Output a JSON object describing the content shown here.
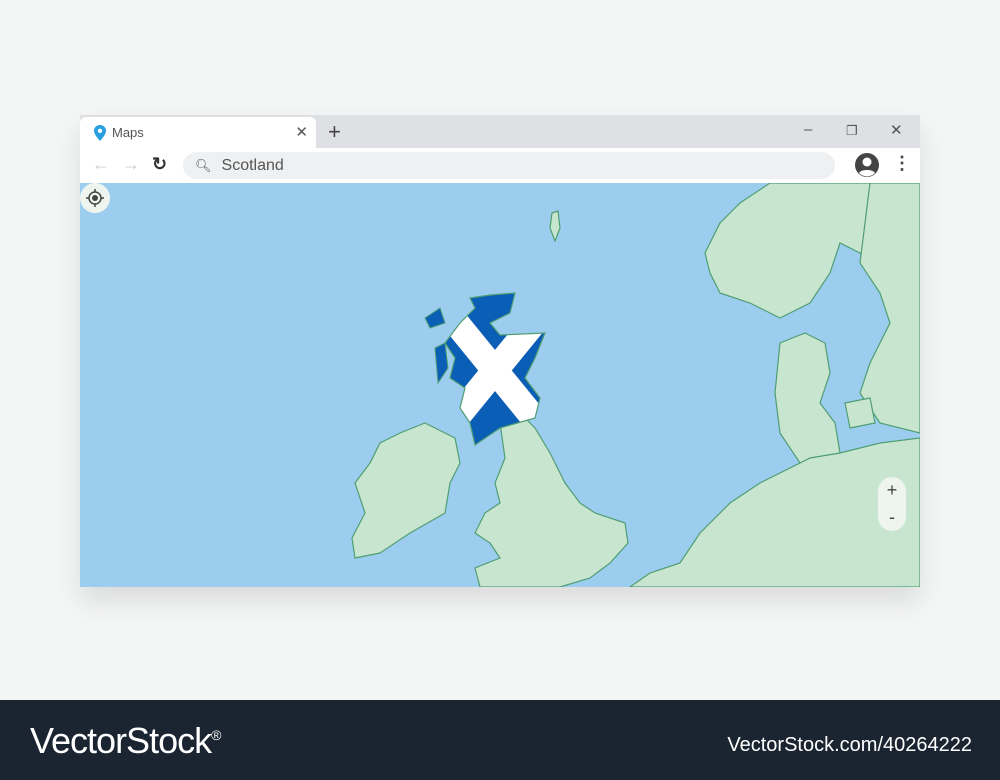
{
  "browser": {
    "tab_title": "Maps",
    "tab_icon": "map-pin-icon",
    "new_tab_label": "+",
    "search_value": "Scotland",
    "window_controls": [
      "minimize",
      "restore",
      "close"
    ]
  },
  "map": {
    "highlighted_country": "Scotland",
    "zoom_in_label": "+",
    "zoom_out_label": "-",
    "colors": {
      "sea": "#9dcdee",
      "land": "#c8e6cf",
      "border": "#4f9e73",
      "flag_blue": "#0b5eb5",
      "flag_white": "#ffffff"
    }
  },
  "footer": {
    "brand": "VectorStock",
    "registered": "®",
    "image_id": "VectorStock.com/40264222"
  },
  "watermark": "VectorStock"
}
